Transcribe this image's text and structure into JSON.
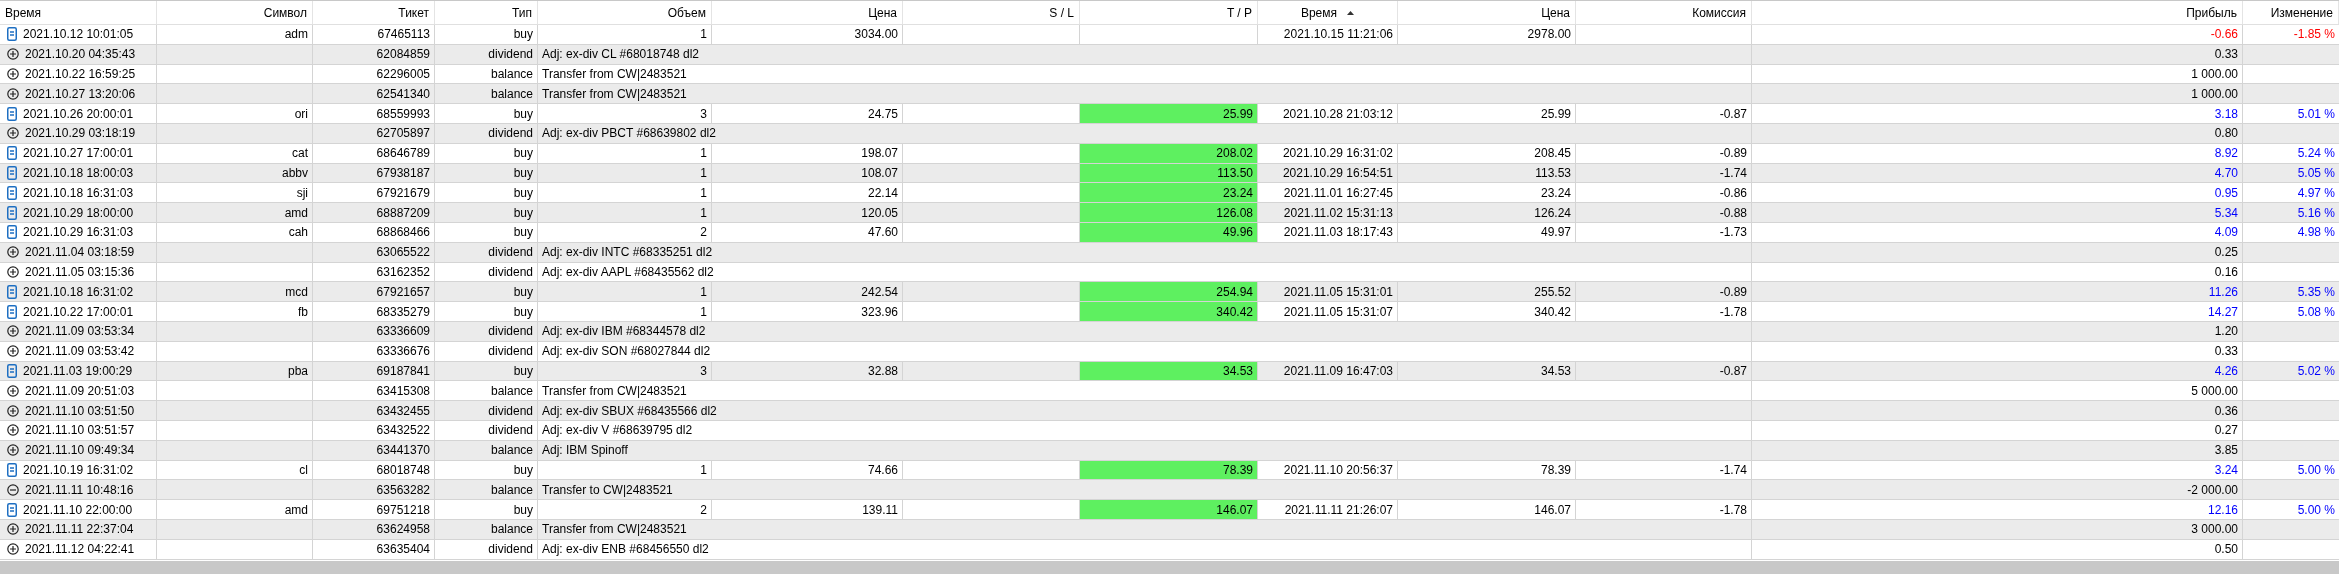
{
  "columns": [
    {
      "label": "Время",
      "sorted": false
    },
    {
      "label": "Символ",
      "sorted": false
    },
    {
      "label": "Тикет",
      "sorted": false
    },
    {
      "label": "Тип",
      "sorted": false
    },
    {
      "label": "Объем",
      "sorted": false
    },
    {
      "label": "Цена",
      "sorted": false
    },
    {
      "label": "S / L",
      "sorted": false
    },
    {
      "label": "T / P",
      "sorted": false
    },
    {
      "label": "Время",
      "sorted": true
    },
    {
      "label": "Цена",
      "sorted": false
    },
    {
      "label": "Комиссия",
      "sorted": false
    },
    {
      "label": "Прибыль",
      "sorted": false
    },
    {
      "label": "Изменение",
      "sorted": false
    }
  ],
  "rows": [
    {
      "kind": "trade",
      "time": "2021.10.12 10:01:05",
      "symbol": "adm",
      "ticket": "67465113",
      "type": "buy",
      "volume": "1",
      "price": "3034.00",
      "tp_highlighted": false,
      "close_time": "2021.10.15 11:21:06",
      "close_price": "2978.00",
      "profit": "-0.66",
      "change": "-1.85 %",
      "color": "#ff0000"
    },
    {
      "kind": "credit",
      "time": "2021.10.20 04:35:43",
      "ticket": "62084859",
      "type": "dividend",
      "comment": "Adj: ex-div CL #68018748 dl2",
      "profit": "0.33"
    },
    {
      "kind": "credit",
      "time": "2021.10.22 16:59:25",
      "ticket": "62296005",
      "type": "balance",
      "comment": "Transfer from CW|2483521",
      "profit": "1 000.00"
    },
    {
      "kind": "credit",
      "time": "2021.10.27 13:20:06",
      "ticket": "62541340",
      "type": "balance",
      "comment": "Transfer from CW|2483521",
      "profit": "1 000.00"
    },
    {
      "kind": "trade",
      "time": "2021.10.26 20:00:01",
      "symbol": "ori",
      "ticket": "68559993",
      "type": "buy",
      "volume": "3",
      "price": "24.75",
      "tp": "25.99",
      "tp_highlighted": true,
      "close_time": "2021.10.28 21:03:12",
      "close_price": "25.99",
      "commission": "-0.87",
      "profit": "3.18",
      "change": "5.01 %",
      "color": "#0000ff"
    },
    {
      "kind": "credit",
      "time": "2021.10.29 03:18:19",
      "ticket": "62705897",
      "type": "dividend",
      "comment": "Adj: ex-div PBCT #68639802 dl2",
      "profit": "0.80"
    },
    {
      "kind": "trade",
      "time": "2021.10.27 17:00:01",
      "symbol": "cat",
      "ticket": "68646789",
      "type": "buy",
      "volume": "1",
      "price": "198.07",
      "tp": "208.02",
      "tp_highlighted": true,
      "close_time": "2021.10.29 16:31:02",
      "close_price": "208.45",
      "commission": "-0.89",
      "profit": "8.92",
      "change": "5.24 %",
      "color": "#0000ff"
    },
    {
      "kind": "trade",
      "time": "2021.10.18 18:00:03",
      "symbol": "abbv",
      "ticket": "67938187",
      "type": "buy",
      "volume": "1",
      "price": "108.07",
      "tp": "113.50",
      "tp_highlighted": true,
      "close_time": "2021.10.29 16:54:51",
      "close_price": "113.53",
      "commission": "-1.74",
      "profit": "4.70",
      "change": "5.05 %",
      "color": "#0000ff"
    },
    {
      "kind": "trade",
      "time": "2021.10.18 16:31:03",
      "symbol": "sji",
      "ticket": "67921679",
      "type": "buy",
      "volume": "1",
      "price": "22.14",
      "tp": "23.24",
      "tp_highlighted": true,
      "close_time": "2021.11.01 16:27:45",
      "close_price": "23.24",
      "commission": "-0.86",
      "profit": "0.95",
      "change": "4.97 %",
      "color": "#0000ff"
    },
    {
      "kind": "trade",
      "time": "2021.10.29 18:00:00",
      "symbol": "amd",
      "ticket": "68887209",
      "type": "buy",
      "volume": "1",
      "price": "120.05",
      "tp": "126.08",
      "tp_highlighted": true,
      "close_time": "2021.11.02 15:31:13",
      "close_price": "126.24",
      "commission": "-0.88",
      "profit": "5.34",
      "change": "5.16 %",
      "color": "#0000ff"
    },
    {
      "kind": "trade",
      "time": "2021.10.29 16:31:03",
      "symbol": "cah",
      "ticket": "68868466",
      "type": "buy",
      "volume": "2",
      "price": "47.60",
      "tp": "49.96",
      "tp_highlighted": true,
      "close_time": "2021.11.03 18:17:43",
      "close_price": "49.97",
      "commission": "-1.73",
      "profit": "4.09",
      "change": "4.98 %",
      "color": "#0000ff"
    },
    {
      "kind": "credit",
      "time": "2021.11.04 03:18:59",
      "ticket": "63065522",
      "type": "dividend",
      "comment": "Adj: ex-div INTC #68335251 dl2",
      "profit": "0.25"
    },
    {
      "kind": "credit",
      "time": "2021.11.05 03:15:36",
      "ticket": "63162352",
      "type": "dividend",
      "comment": "Adj: ex-div AAPL #68435562 dl2",
      "profit": "0.16"
    },
    {
      "kind": "trade",
      "time": "2021.10.18 16:31:02",
      "symbol": "mcd",
      "ticket": "67921657",
      "type": "buy",
      "volume": "1",
      "price": "242.54",
      "tp": "254.94",
      "tp_highlighted": true,
      "close_time": "2021.11.05 15:31:01",
      "close_price": "255.52",
      "commission": "-0.89",
      "profit": "11.26",
      "change": "5.35 %",
      "color": "#0000ff"
    },
    {
      "kind": "trade",
      "time": "2021.10.22 17:00:01",
      "symbol": "fb",
      "ticket": "68335279",
      "type": "buy",
      "volume": "1",
      "price": "323.96",
      "tp": "340.42",
      "tp_highlighted": true,
      "close_time": "2021.11.05 15:31:07",
      "close_price": "340.42",
      "commission": "-1.78",
      "profit": "14.27",
      "change": "5.08 %",
      "color": "#0000ff"
    },
    {
      "kind": "credit",
      "time": "2021.11.09 03:53:34",
      "ticket": "63336609",
      "type": "dividend",
      "comment": "Adj: ex-div IBM #68344578 dl2",
      "profit": "1.20"
    },
    {
      "kind": "credit",
      "time": "2021.11.09 03:53:42",
      "ticket": "63336676",
      "type": "dividend",
      "comment": "Adj: ex-div SON #68027844 dl2",
      "profit": "0.33"
    },
    {
      "kind": "trade",
      "time": "2021.11.03 19:00:29",
      "symbol": "pba",
      "ticket": "69187841",
      "type": "buy",
      "volume": "3",
      "price": "32.88",
      "tp": "34.53",
      "tp_highlighted": true,
      "close_time": "2021.11.09 16:47:03",
      "close_price": "34.53",
      "commission": "-0.87",
      "profit": "4.26",
      "change": "5.02 %",
      "color": "#0000ff"
    },
    {
      "kind": "credit",
      "time": "2021.11.09 20:51:03",
      "ticket": "63415308",
      "type": "balance",
      "comment": "Transfer from CW|2483521",
      "profit": "5 000.00"
    },
    {
      "kind": "credit",
      "time": "2021.11.10 03:51:50",
      "ticket": "63432455",
      "type": "dividend",
      "comment": "Adj: ex-div SBUX #68435566 dl2",
      "profit": "0.36"
    },
    {
      "kind": "credit",
      "time": "2021.11.10 03:51:57",
      "ticket": "63432522",
      "type": "dividend",
      "comment": "Adj: ex-div V #68639795 dl2",
      "profit": "0.27"
    },
    {
      "kind": "credit",
      "time": "2021.11.10 09:49:34",
      "ticket": "63441370",
      "type": "balance",
      "comment": "Adj: IBM Spinoff",
      "profit": "3.85"
    },
    {
      "kind": "trade",
      "time": "2021.10.19 16:31:02",
      "symbol": "cl",
      "ticket": "68018748",
      "type": "buy",
      "volume": "1",
      "price": "74.66",
      "tp": "78.39",
      "tp_highlighted": true,
      "close_time": "2021.11.10 20:56:37",
      "close_price": "78.39",
      "commission": "-1.74",
      "profit": "3.24",
      "change": "5.00 %",
      "color": "#0000ff"
    },
    {
      "kind": "debit",
      "time": "2021.11.11 10:48:16",
      "ticket": "63563282",
      "type": "balance",
      "comment": "Transfer to CW|2483521",
      "profit": "-2 000.00"
    },
    {
      "kind": "trade",
      "time": "2021.11.10 22:00:00",
      "symbol": "amd",
      "ticket": "69751218",
      "type": "buy",
      "volume": "2",
      "price": "139.11",
      "tp": "146.07",
      "tp_highlighted": true,
      "close_time": "2021.11.11 21:26:07",
      "close_price": "146.07",
      "commission": "-1.78",
      "profit": "12.16",
      "change": "5.00 %",
      "color": "#0000ff"
    },
    {
      "kind": "credit",
      "time": "2021.11.11 22:37:04",
      "ticket": "63624958",
      "type": "balance",
      "comment": "Transfer from CW|2483521",
      "profit": "3 000.00"
    },
    {
      "kind": "credit",
      "time": "2021.11.12 04:22:41",
      "ticket": "63635404",
      "type": "dividend",
      "comment": "Adj: ex-div ENB #68456550 dl2",
      "profit": "0.50"
    }
  ]
}
